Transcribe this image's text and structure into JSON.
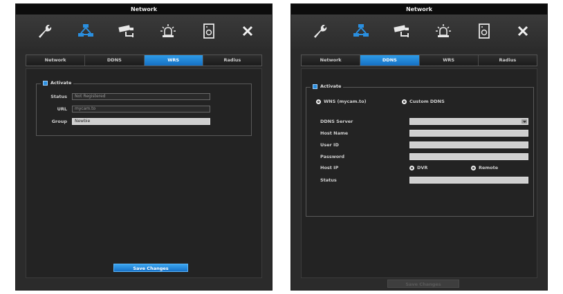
{
  "left": {
    "title": "Network",
    "tabs": [
      "Network",
      "DDNS",
      "WRS",
      "Radius"
    ],
    "active_tab": "WRS",
    "activate_label": "Activate",
    "status_label": "Status",
    "status_value": "Not Registered",
    "url_label": "URL",
    "url_value": "mycam.to",
    "group_label": "Group",
    "group_value": "Newbie",
    "save_label": "Save Changes"
  },
  "right": {
    "title": "Network",
    "tabs": [
      "Network",
      "DDNS",
      "WRS",
      "Radius"
    ],
    "active_tab": "DDNS",
    "activate_label": "Activate",
    "wns_option": "WNS (mycam.to)",
    "custom_option": "Custom DDNS",
    "ddns_server_label": "DDNS Server",
    "host_name_label": "Host Name",
    "user_id_label": "User ID",
    "password_label": "Password",
    "host_ip_label": "Host IP",
    "dvr_option": "DVR",
    "remote_option": "Remote",
    "status_label": "Status",
    "save_label": "Save Changes"
  },
  "icons": [
    "wrench-icon",
    "network-icon",
    "camera-icon",
    "alarm-icon",
    "storage-icon",
    "close-icon"
  ],
  "colors": {
    "accent": "#1f86d8",
    "panel": "#2b2b2b",
    "titlebar": "#0c0c0c"
  }
}
